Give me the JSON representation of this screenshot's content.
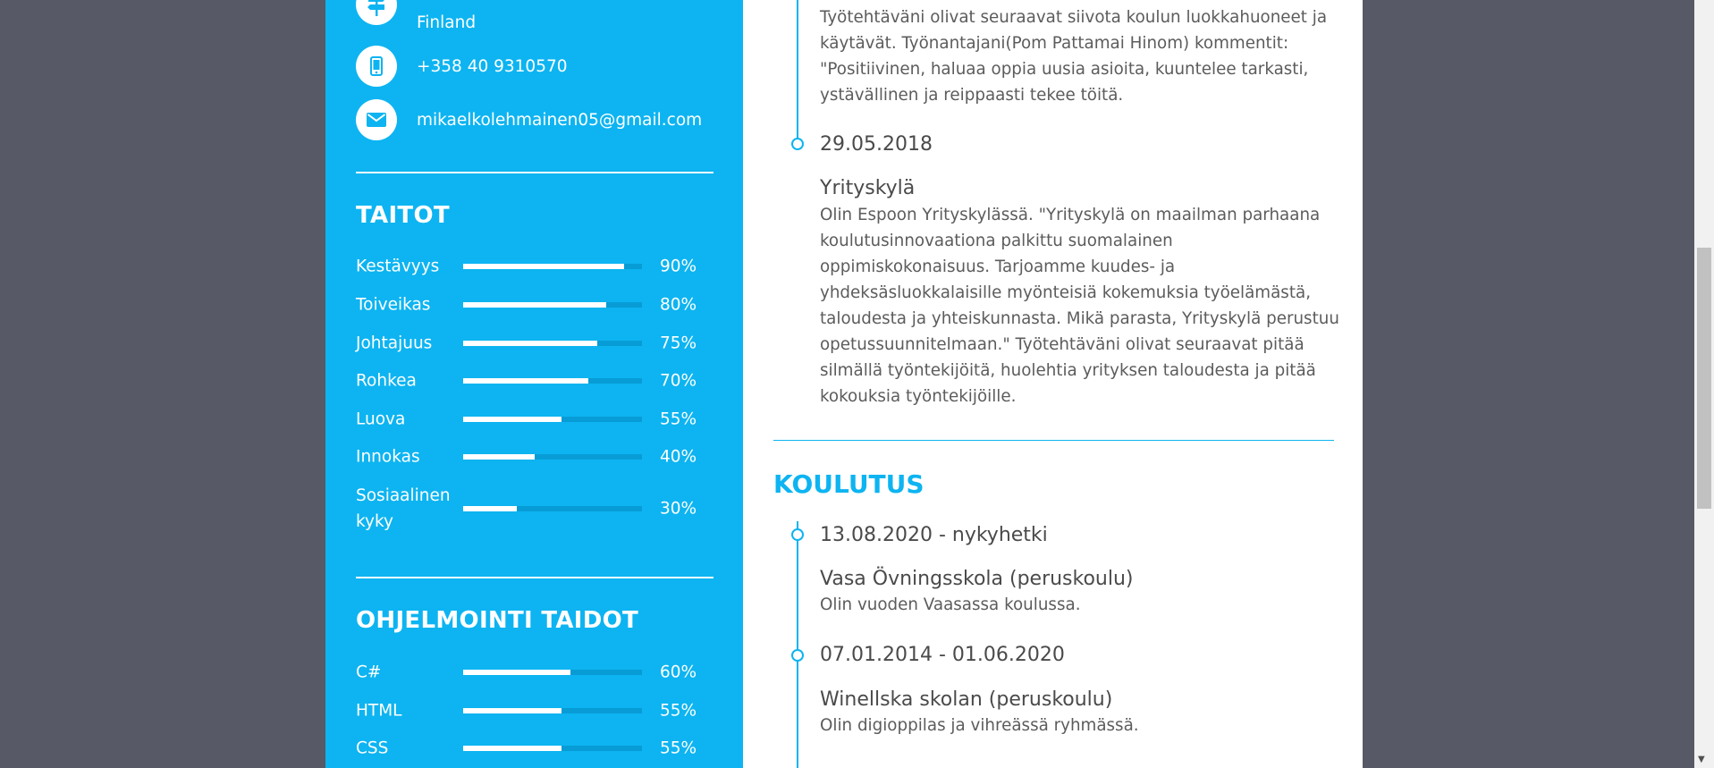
{
  "contact": {
    "address_line": "Finland",
    "phone": "+358 40 9310570",
    "email": "mikaelkolehmainen05@gmail.com"
  },
  "skills": {
    "title": "TAITOT",
    "items": [
      {
        "label": "Kestävyys",
        "pct_text": "90%",
        "level": 0.9
      },
      {
        "label": "Toiveikas",
        "pct_text": "80%",
        "level": 0.8
      },
      {
        "label": "Johtajuus",
        "pct_text": "75%",
        "level": 0.75
      },
      {
        "label": "Rohkea",
        "pct_text": "70%",
        "level": 0.7
      },
      {
        "label": "Luova",
        "pct_text": "55%",
        "level": 0.55
      },
      {
        "label": "Innokas",
        "pct_text": "40%",
        "level": 0.4
      },
      {
        "label": "Sosiaalinen kyky",
        "pct_text": "30%",
        "level": 0.3
      }
    ]
  },
  "programming": {
    "title": "OHJELMOINTI TAIDOT",
    "items": [
      {
        "label": "C#",
        "pct_text": "60%",
        "level": 0.6
      },
      {
        "label": "HTML",
        "pct_text": "55%",
        "level": 0.55
      },
      {
        "label": "CSS",
        "pct_text": "55%",
        "level": 0.55
      }
    ]
  },
  "experience": {
    "top_desc": "Työtehtäväni olivat seuraavat siivota koulun luokkahuoneet ja käytävät. Työnantajani(Pom Pattamai Hinom) kommentit: \"Positiivinen, haluaa oppia uusia asioita, kuuntelee tarkasti, ystävällinen ja reippaasti tekee töitä.",
    "entry2": {
      "date": "29.05.2018",
      "title": "Yrityskylä",
      "desc": "Olin Espoon Yrityskylässä. \"Yrityskylä on maailman parhaana koulutusinnovaationa palkittu suomalainen oppimiskokonaisuus. Tarjoamme kuudes- ja yhdeksäsluokkalaisille myönteisiä kokemuksia työelämästä, taloudesta ja yhteiskunnasta. Mikä parasta, Yrityskylä perustuu opetussuunnitelmaan.\" Työtehtäväni olivat seuraavat pitää silmällä työntekijöitä, huolehtia yrityksen taloudesta ja pitää kokouksia työntekijöille."
    }
  },
  "education": {
    "title": "KOULUTUS",
    "entries": [
      {
        "date": "13.08.2020 - nykyhetki",
        "title": "Vasa Övningsskola (peruskoulu)",
        "desc": "Olin vuoden Vaasassa koulussa."
      },
      {
        "date": "07.01.2014 - 01.06.2020",
        "title": "Winellska skolan (peruskoulu)",
        "desc": "Olin digioppilas ja vihreässä ryhmässä."
      }
    ]
  },
  "colors": {
    "accent": "#0db4f1",
    "track": "#079cd6",
    "background": "#575a66"
  }
}
